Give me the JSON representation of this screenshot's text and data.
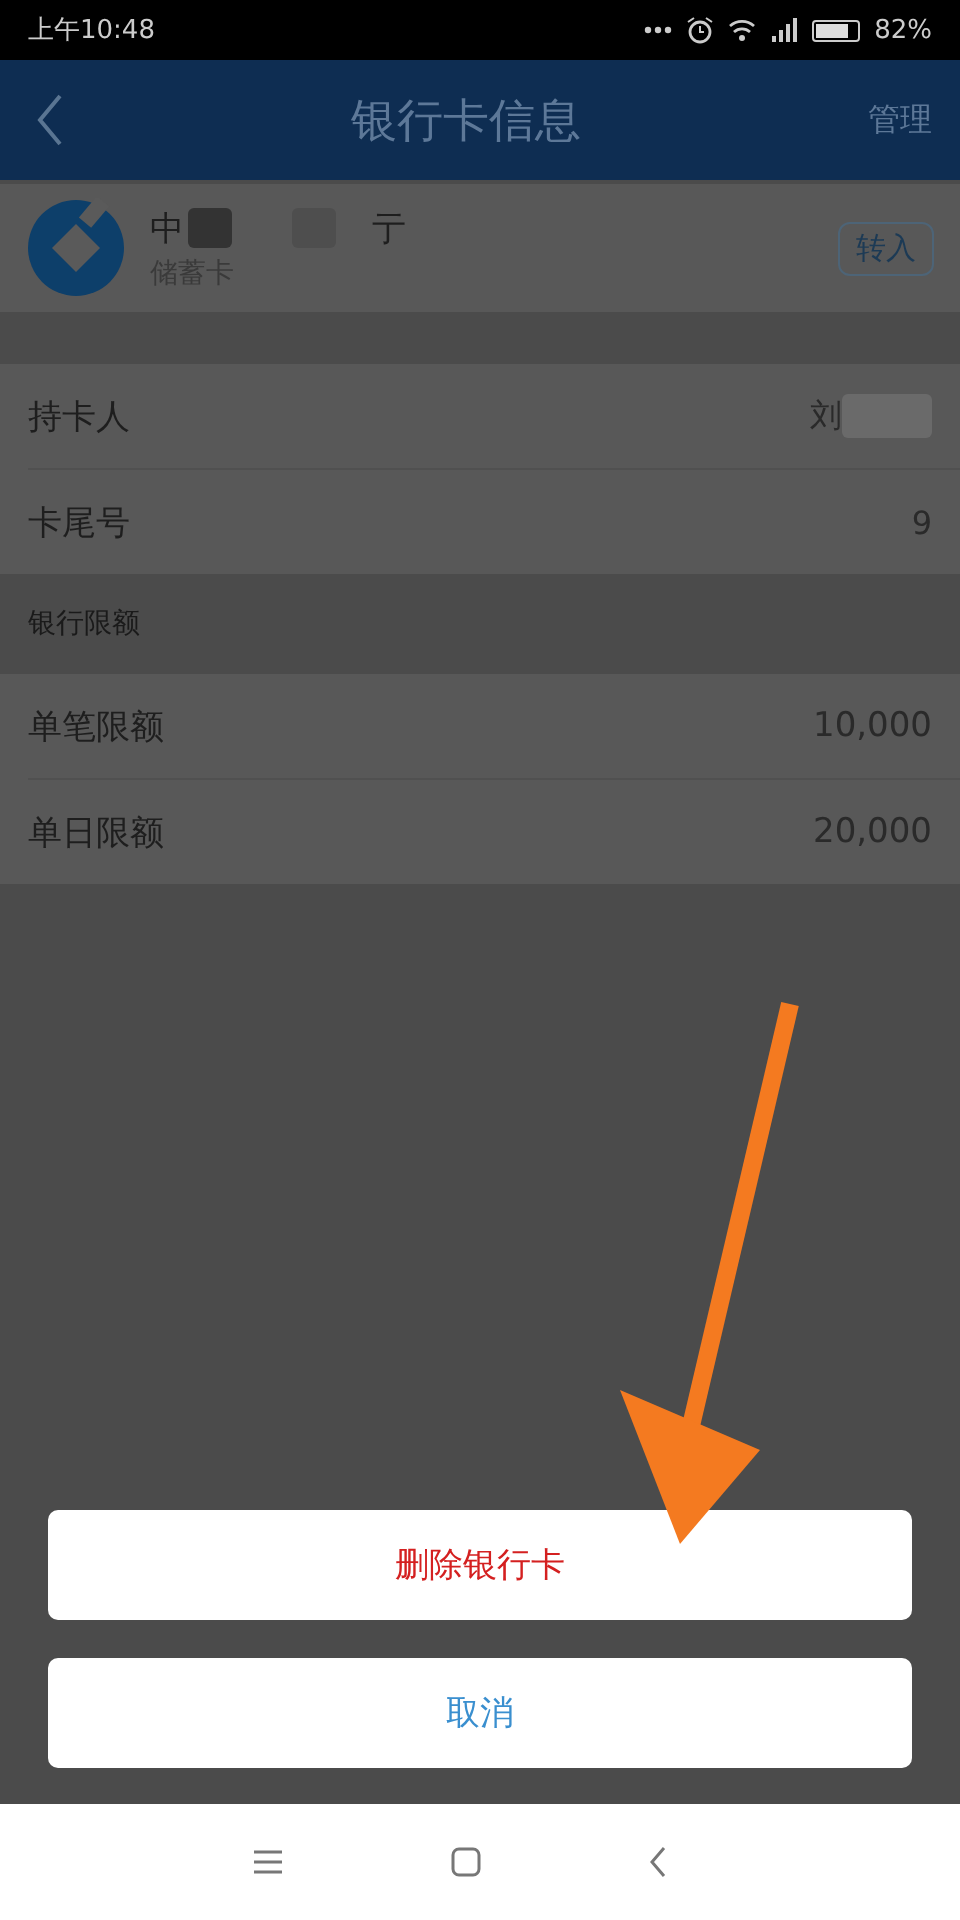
{
  "status_bar": {
    "time": "上午10:48",
    "battery_text": "82%"
  },
  "header": {
    "title": "银行卡信息",
    "action": "管理"
  },
  "card": {
    "bank_name_start": "中",
    "bank_name_end": "亍",
    "card_type": "储蓄卡",
    "transfer_button": "转入"
  },
  "info_rows": [
    {
      "label": "持卡人",
      "value": "刘"
    },
    {
      "label": "卡尾号",
      "value": "9"
    }
  ],
  "limits_section": {
    "title": "银行限额",
    "rows": [
      {
        "label": "单笔限额",
        "value": "10,000"
      },
      {
        "label": "单日限额",
        "value": "20,000"
      }
    ]
  },
  "action_sheet": {
    "buttons": [
      {
        "label": "删除银行卡",
        "kind": "destructive"
      },
      {
        "label": "取消",
        "kind": "cancel"
      }
    ]
  }
}
